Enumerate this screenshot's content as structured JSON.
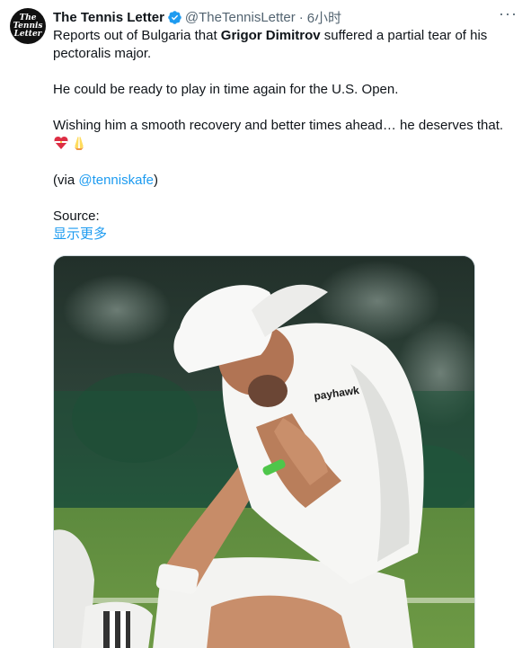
{
  "author": {
    "name": "The Tennis Letter",
    "handle": "@TheTennisLetter",
    "time": "6小时",
    "avatar_text": [
      "The",
      "Tennis",
      "Letter"
    ]
  },
  "tweet": {
    "line1_prefix": "Reports out of Bulgaria that ",
    "line1_bold": "Grigor Dimitrov",
    "line1_suffix": " suffered a partial tear of his pectoralis major.",
    "line2": "He could be ready to play in time again for the U.S. Open.",
    "line3": "Wishing him a smooth recovery and better times ahead… he deserves that.",
    "via_prefix": "(via ",
    "via_link": "@tenniskafe",
    "via_suffix": ")",
    "source_label": "Source:",
    "show_more": "显示更多"
  },
  "icons": {
    "verified": "verified-badge-icon",
    "more": "more-options-icon",
    "heart_emoji": "heart-with-ribbon-emoji",
    "pray_emoji": "folded-hands-emoji"
  },
  "media": {
    "shirt_logo": "payhawk"
  },
  "colors": {
    "link": "#1d9bf0",
    "text": "#0f1419",
    "secondary": "#536471"
  }
}
